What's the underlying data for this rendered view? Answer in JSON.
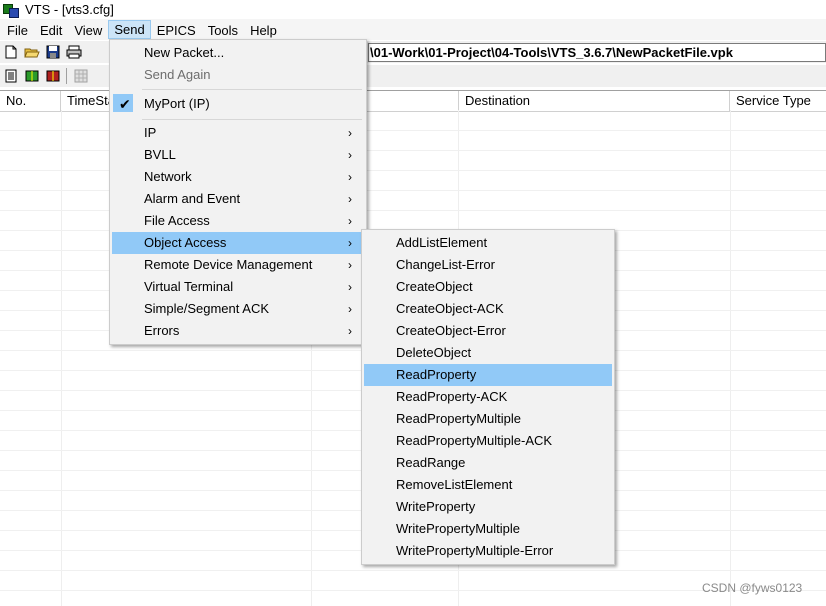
{
  "window": {
    "title": "VTS - [vts3.cfg]"
  },
  "menubar": {
    "items": [
      {
        "label": "File"
      },
      {
        "label": "Edit"
      },
      {
        "label": "View"
      },
      {
        "label": "Send"
      },
      {
        "label": "EPICS"
      },
      {
        "label": "Tools"
      },
      {
        "label": "Help"
      }
    ],
    "active": "Send"
  },
  "toolbar": {
    "path": "\\01-Work\\01-Project\\04-Tools\\VTS_3.6.7\\NewPacketFile.vpk"
  },
  "table": {
    "columns": [
      {
        "label": "No."
      },
      {
        "label": "TimeSta"
      },
      {
        "label": "Destination"
      },
      {
        "label": "Service Type"
      }
    ]
  },
  "send_menu": {
    "new_packet": "New Packet...",
    "send_again": "Send Again",
    "myport": "MyPort (IP)",
    "items": [
      {
        "label": "IP"
      },
      {
        "label": "BVLL"
      },
      {
        "label": "Network"
      },
      {
        "label": "Alarm and Event"
      },
      {
        "label": "File Access"
      },
      {
        "label": "Object Access"
      },
      {
        "label": "Remote Device Management"
      },
      {
        "label": "Virtual Terminal"
      },
      {
        "label": "Simple/Segment ACK"
      },
      {
        "label": "Errors"
      }
    ],
    "highlighted": "Object Access"
  },
  "object_access_menu": {
    "items": [
      {
        "label": "AddListElement"
      },
      {
        "label": "ChangeList-Error"
      },
      {
        "label": "CreateObject"
      },
      {
        "label": "CreateObject-ACK"
      },
      {
        "label": "CreateObject-Error"
      },
      {
        "label": "DeleteObject"
      },
      {
        "label": "ReadProperty"
      },
      {
        "label": "ReadProperty-ACK"
      },
      {
        "label": "ReadPropertyMultiple"
      },
      {
        "label": "ReadPropertyMultiple-ACK"
      },
      {
        "label": "ReadRange"
      },
      {
        "label": "RemoveListElement"
      },
      {
        "label": "WriteProperty"
      },
      {
        "label": "WritePropertyMultiple"
      },
      {
        "label": "WritePropertyMultiple-Error"
      }
    ],
    "highlighted": "ReadProperty"
  },
  "watermark": "CSDN @fyws0123",
  "icons": {
    "arrow": "›",
    "check": "✔"
  }
}
